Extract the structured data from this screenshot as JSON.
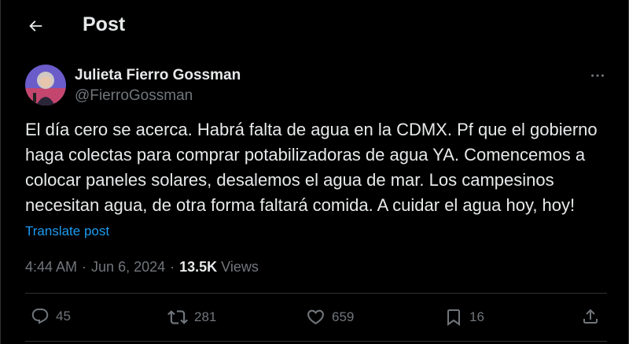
{
  "header": {
    "title": "Post"
  },
  "author": {
    "name": "Julieta Fierro Gossman",
    "handle": "@FierroGossman"
  },
  "tweet": {
    "text": "El día cero se acerca. Habrá falta de agua en la CDMX. Pf que el gobierno haga colectas para comprar potabilizadoras de agua YA. Comencemos a colocar paneles solares, desalemos el agua de mar. Los campesinos necesitan agua, de otra forma faltará comida. A cuidar el agua hoy, hoy!",
    "translate_label": "Translate post"
  },
  "meta": {
    "time": "4:44 AM",
    "date": "Jun 6, 2024",
    "views_count": "13.5K",
    "views_label": "Views",
    "separator": "·"
  },
  "actions": {
    "replies": "45",
    "reposts": "281",
    "likes": "659",
    "bookmarks": "16"
  },
  "icons": {
    "back": "arrow-left-icon",
    "more": "more-horizontal-icon",
    "reply": "reply-icon",
    "repost": "repost-icon",
    "like": "heart-icon",
    "bookmark": "bookmark-icon",
    "share": "share-icon"
  },
  "colors": {
    "background": "#000000",
    "text_primary": "#e7e9ea",
    "text_secondary": "#71767b",
    "link": "#1d9bf0",
    "divider": "#2f3336"
  }
}
